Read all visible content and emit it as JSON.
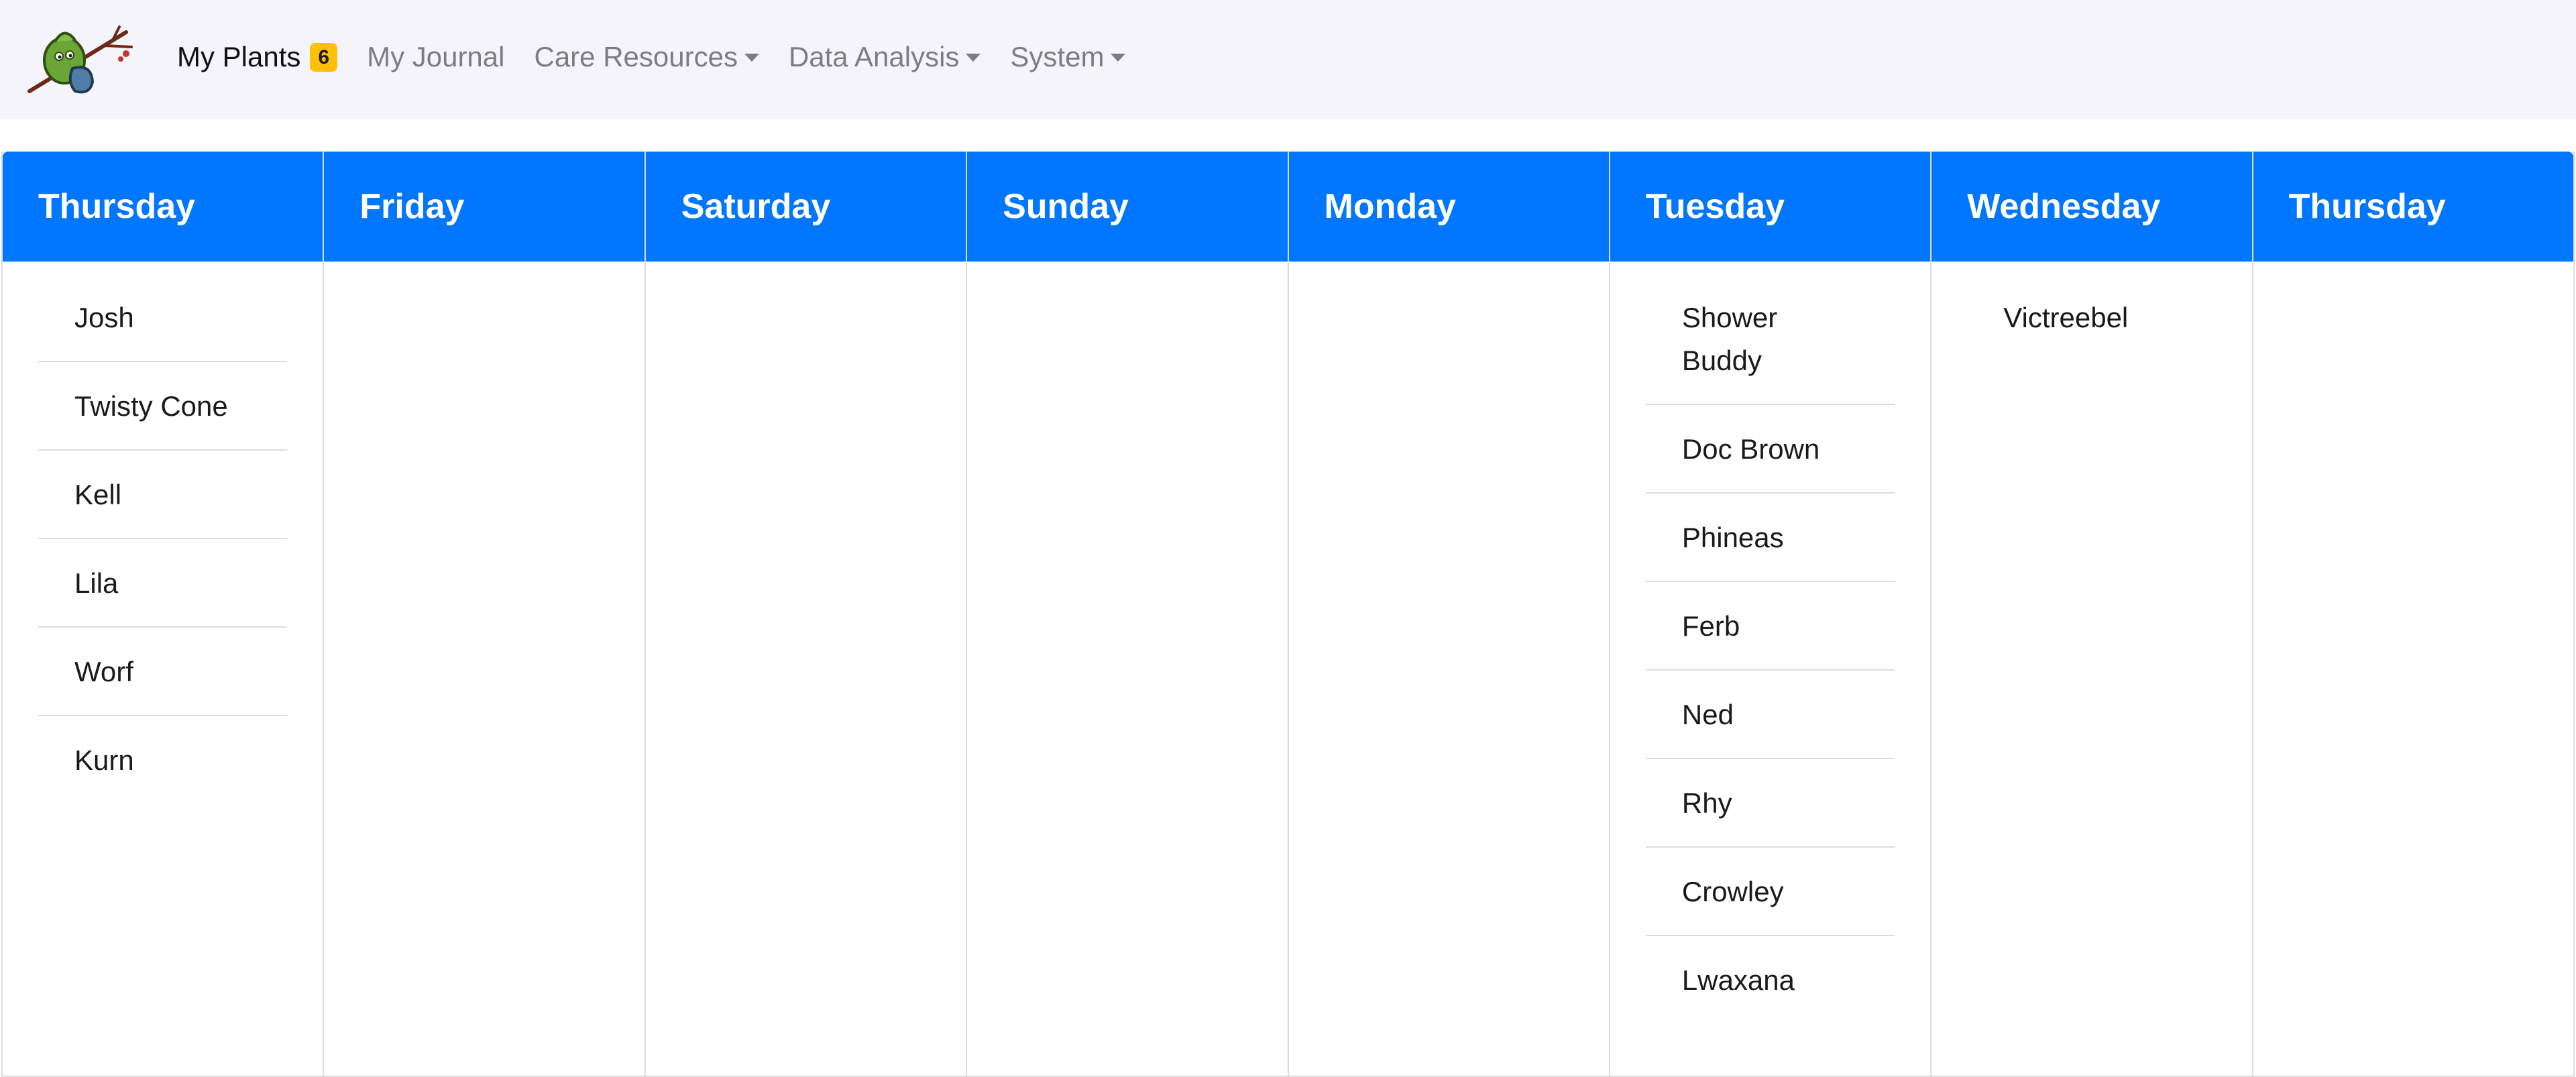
{
  "nav": {
    "items": [
      {
        "label": "My Plants",
        "badge": "6",
        "active": true,
        "dropdown": false
      },
      {
        "label": "My Journal",
        "active": false,
        "dropdown": false
      },
      {
        "label": "Care Resources",
        "active": false,
        "dropdown": true
      },
      {
        "label": "Data Analysis",
        "active": false,
        "dropdown": true
      },
      {
        "label": "System",
        "active": false,
        "dropdown": true
      }
    ]
  },
  "colors": {
    "header": "#0177ff",
    "badge": "#ffc107",
    "navbar_bg": "#f5f4fa"
  },
  "calendar": {
    "days": [
      {
        "name": "Thursday",
        "plants": [
          "Josh",
          "Twisty Cone",
          "Kell",
          "Lila",
          "Worf",
          "Kurn"
        ]
      },
      {
        "name": "Friday",
        "plants": []
      },
      {
        "name": "Saturday",
        "plants": []
      },
      {
        "name": "Sunday",
        "plants": []
      },
      {
        "name": "Monday",
        "plants": []
      },
      {
        "name": "Tuesday",
        "plants": [
          "Shower Buddy",
          "Doc Brown",
          "Phineas",
          "Ferb",
          "Ned",
          "Rhy",
          "Crowley",
          "Lwaxana"
        ]
      },
      {
        "name": "Wednesday",
        "plants": [
          "Victreebel"
        ]
      },
      {
        "name": "Thursday",
        "plants": []
      }
    ]
  }
}
